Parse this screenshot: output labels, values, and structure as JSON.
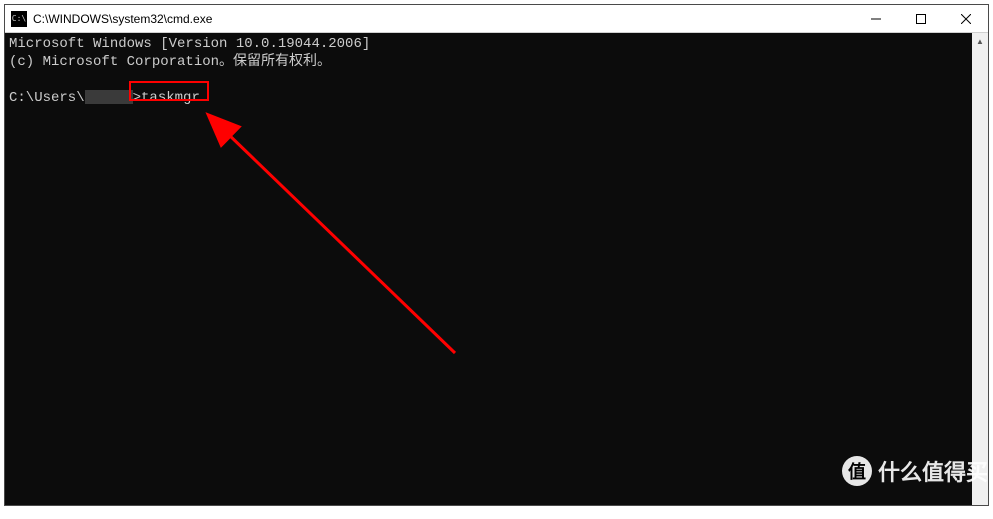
{
  "titlebar": {
    "icon_glyph": "C:\\",
    "title": "C:\\WINDOWS\\system32\\cmd.exe"
  },
  "console": {
    "line1": "Microsoft Windows [Version 10.0.19044.2006]",
    "line2": "(c) Microsoft Corporation。保留所有权利。",
    "prompt_prefix": "C:\\Users\\",
    "prompt_suffix": ">",
    "command": "taskmgr"
  },
  "annotation": {
    "highlight_color": "#ff0000"
  },
  "watermark": {
    "badge": "值",
    "text": "什么值得买"
  }
}
